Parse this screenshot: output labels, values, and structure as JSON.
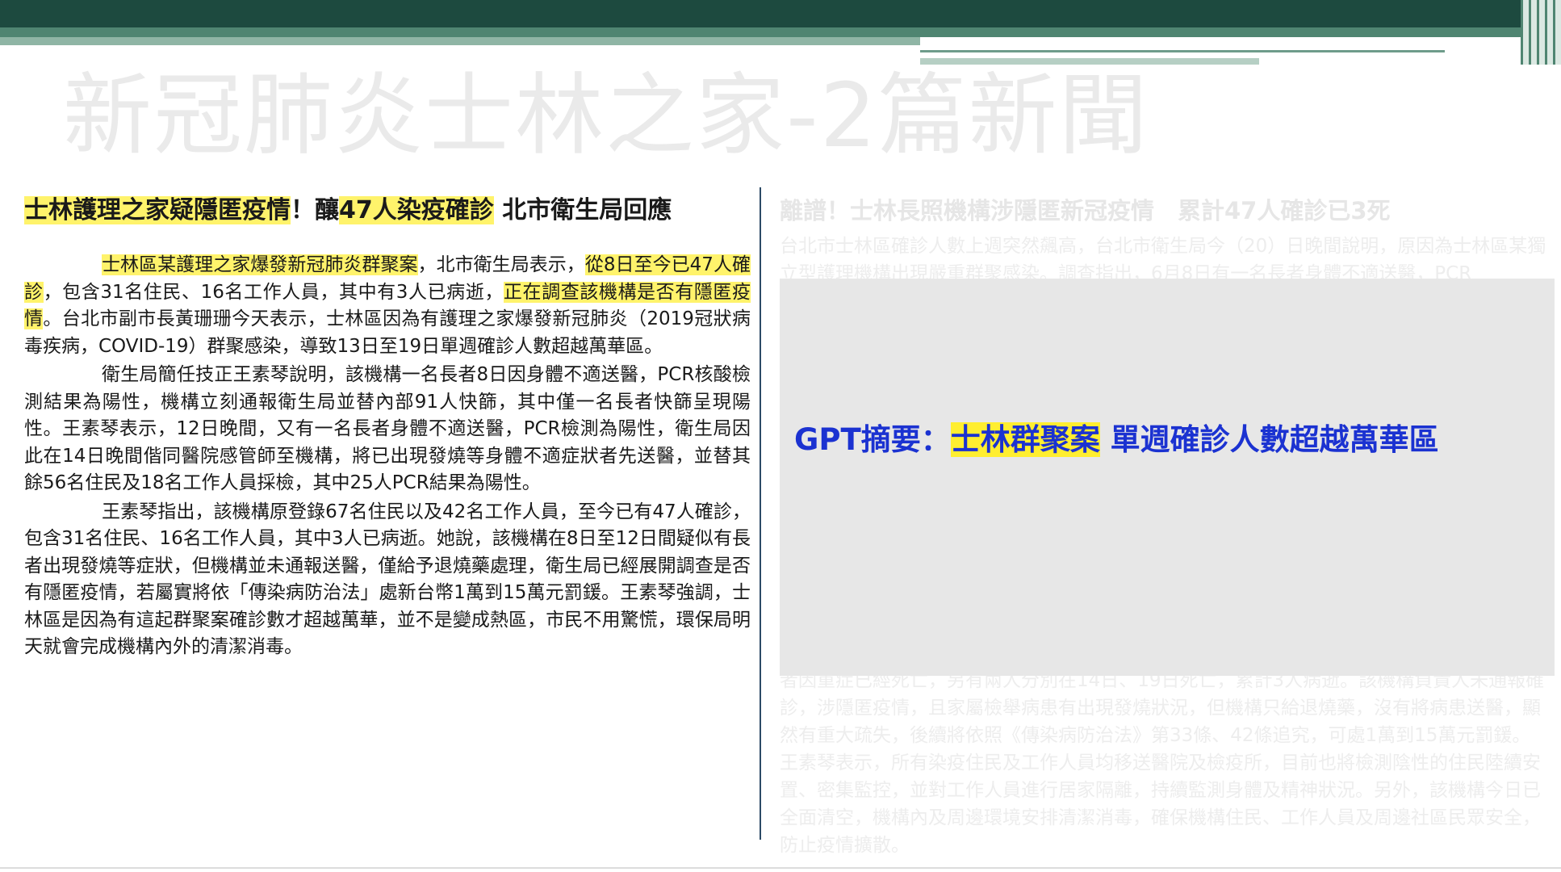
{
  "slide_title": "新冠肺炎士林之家-2篇新聞",
  "left_article": {
    "headline": [
      {
        "text": "士林護理之家疑隱匿疫情",
        "hl": true
      },
      {
        "text": "！釀",
        "hl": false
      },
      {
        "text": "47人染疫確診",
        "hl": true
      },
      {
        "text": " 北市衛生局回應",
        "hl": false
      }
    ],
    "paragraphs": [
      [
        {
          "text": "士林區某護理之家爆發新冠肺炎群聚案",
          "hl": true
        },
        {
          "text": "，北市衛生局表示，",
          "hl": false
        },
        {
          "text": "從8日至今已47人確診",
          "hl": true
        },
        {
          "text": "，包含31名住民、16名工作人員，其中有3人已病逝，",
          "hl": false
        },
        {
          "text": "正在調查該機構是否有隱匿疫情",
          "hl": true
        },
        {
          "text": "。台北市副市長黃珊珊今天表示，士林區因為有護理之家爆發新冠肺炎（2019冠狀病毒疾病，COVID-19）群聚感染，導致13日至19日單週確診人數超越萬華區。",
          "hl": false
        }
      ],
      [
        {
          "text": "衛生局簡任技正王素琴說明，該機構一名長者8日因身體不適送醫，PCR核酸檢測結果為陽性，機構立刻通報衛生局並替內部91人快篩，其中僅一名長者快篩呈現陽性。王素琴表示，12日晚間，又有一名長者身體不適送醫，PCR檢測為陽性，衛生局因此在14日晚間偕同醫院感管師至機構，將已出現發燒等身體不適症狀者先送醫，並替其餘56名住民及18名工作人員採檢，其中25人PCR結果為陽性。",
          "hl": false
        }
      ],
      [
        {
          "text": "王素琴指出，該機構原登錄67名住民以及42名工作人員，至今已有47人確診，包含31名住民、16名工作人員，其中3人已病逝。她說，該機構在8日至12日間疑似有長者出現發燒等症狀，但機構並未通報送醫，僅給予退燒藥處理，衛生局已經展開調查是否有隱匿疫情，若屬實將依「傳染病防治法」處新台幣1萬到15萬元罰鍰。王素琴強調，士林區是因為有這起群聚案確診數才超越萬華，並不是變成熱區，市民不用驚慌，環保局明天就會完成機構內外的清潔消毒。",
          "hl": false
        }
      ]
    ]
  },
  "right_article": {
    "headline": "離譜！士林長照機構涉隱匿新冠疫情　累計47人確診已3死",
    "top_text": "台北市士林區確診人數上週突然飆高，台北市衛生局今（20）日晚間說明，原因為士林區某獨立型護理機構出現嚴重群聚感染。調查指出，6月8日有一名長者身體不適送醫，PCR",
    "bottom_text": "者因重症已經死亡，另有兩人分別在14日、19日死亡，累計3人病逝。該機構負責人未通報確診，涉隱匿疫情，且家屬檢舉病患有出現發燒狀況，但機構只給退燒藥，沒有將病患送醫，顯然有重大疏失，後續將依照《傳染病防治法》第33條、42條追究，可處1萬到15萬元罰鍰。王素琴表示，所有染疫住民及工作人員均移送醫院及檢疫所，目前也將檢測陰性的住民陸續安置、密集監控，並對工作人員進行居家隔離，持續監測身體及精神狀況。另外，該機構今日已全面清空，機構內及周邊環境安排清潔消毒，確保機構住民、工作人員及周邊社區民眾安全，防止疫情擴散。"
  },
  "gpt_summary": {
    "prefix": "GPT摘要：",
    "highlight": "士林群聚案",
    "rest": " 單週確診人數超越萬華區"
  },
  "colors": {
    "top_bar": "#1d4a3f",
    "highlight": "#fff36b",
    "summary_text": "#1b32d1",
    "divider": "#2c4a66"
  }
}
